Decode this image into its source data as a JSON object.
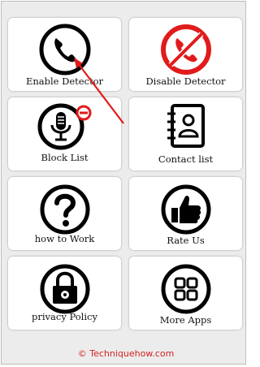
{
  "tiles": [
    {
      "label": "Enable Detector",
      "icon": "phone-icon"
    },
    {
      "label": "Disable Detector",
      "icon": "phone-disabled-icon"
    },
    {
      "label": "Block List",
      "icon": "microphone-block-icon"
    },
    {
      "label": "Contact list",
      "icon": "contact-book-icon"
    },
    {
      "label": "how to Work",
      "icon": "question-mark-icon"
    },
    {
      "label": "Rate Us",
      "icon": "thumbs-up-icon"
    },
    {
      "label": "privacy Policy",
      "icon": "lock-icon"
    },
    {
      "label": "More Apps",
      "icon": "grid-apps-icon"
    }
  ],
  "footer": {
    "text": "© Techniquehow.com"
  },
  "colors": {
    "accent_red": "#e11b1b",
    "icon_black": "#000000",
    "footer_red": "#d32222"
  }
}
